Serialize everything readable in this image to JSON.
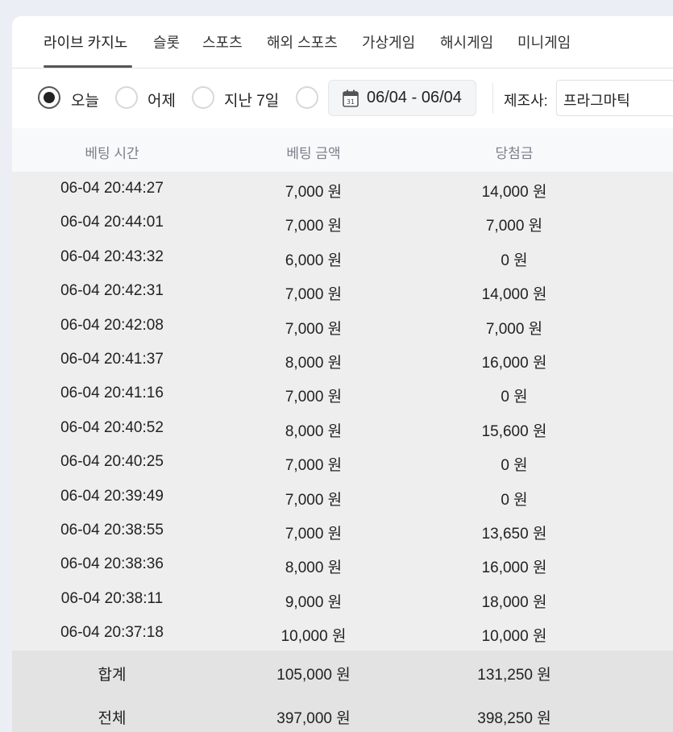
{
  "tabs": [
    {
      "label": "라이브 카지노",
      "active": true
    },
    {
      "label": "슬롯",
      "active": false
    },
    {
      "label": "스포츠",
      "active": false
    },
    {
      "label": "해외 스포츠",
      "active": false
    },
    {
      "label": "가상게임",
      "active": false
    },
    {
      "label": "해시게임",
      "active": false
    },
    {
      "label": "미니게임",
      "active": false
    }
  ],
  "filter": {
    "radios": [
      {
        "label": "오늘",
        "checked": true
      },
      {
        "label": "어제",
        "checked": false
      },
      {
        "label": "지난 7일",
        "checked": false
      },
      {
        "label": "",
        "checked": false
      }
    ],
    "date_range": "06/04 - 06/04",
    "calendar_icon_day": "31",
    "maker_label": "제조사:",
    "maker_value": "프라그마틱"
  },
  "table": {
    "headers": [
      "베팅 시간",
      "베팅 금액",
      "당첨금"
    ],
    "rows": [
      [
        "06-04 20:44:27",
        "7,000 원",
        "14,000 원"
      ],
      [
        "06-04 20:44:01",
        "7,000 원",
        "7,000 원"
      ],
      [
        "06-04 20:43:32",
        "6,000 원",
        "0 원"
      ],
      [
        "06-04 20:42:31",
        "7,000 원",
        "14,000 원"
      ],
      [
        "06-04 20:42:08",
        "7,000 원",
        "7,000 원"
      ],
      [
        "06-04 20:41:37",
        "8,000 원",
        "16,000 원"
      ],
      [
        "06-04 20:41:16",
        "7,000 원",
        "0 원"
      ],
      [
        "06-04 20:40:52",
        "8,000 원",
        "15,600 원"
      ],
      [
        "06-04 20:40:25",
        "7,000 원",
        "0 원"
      ],
      [
        "06-04 20:39:49",
        "7,000 원",
        "0 원"
      ],
      [
        "06-04 20:38:55",
        "7,000 원",
        "13,650 원"
      ],
      [
        "06-04 20:38:36",
        "8,000 원",
        "16,000 원"
      ],
      [
        "06-04 20:38:11",
        "9,000 원",
        "18,000 원"
      ],
      [
        "06-04 20:37:18",
        "10,000 원",
        "10,000 원"
      ]
    ],
    "footer": [
      [
        "합계",
        "105,000 원",
        "131,250 원"
      ],
      [
        "전체",
        "397,000 원",
        "398,250 원"
      ]
    ]
  }
}
